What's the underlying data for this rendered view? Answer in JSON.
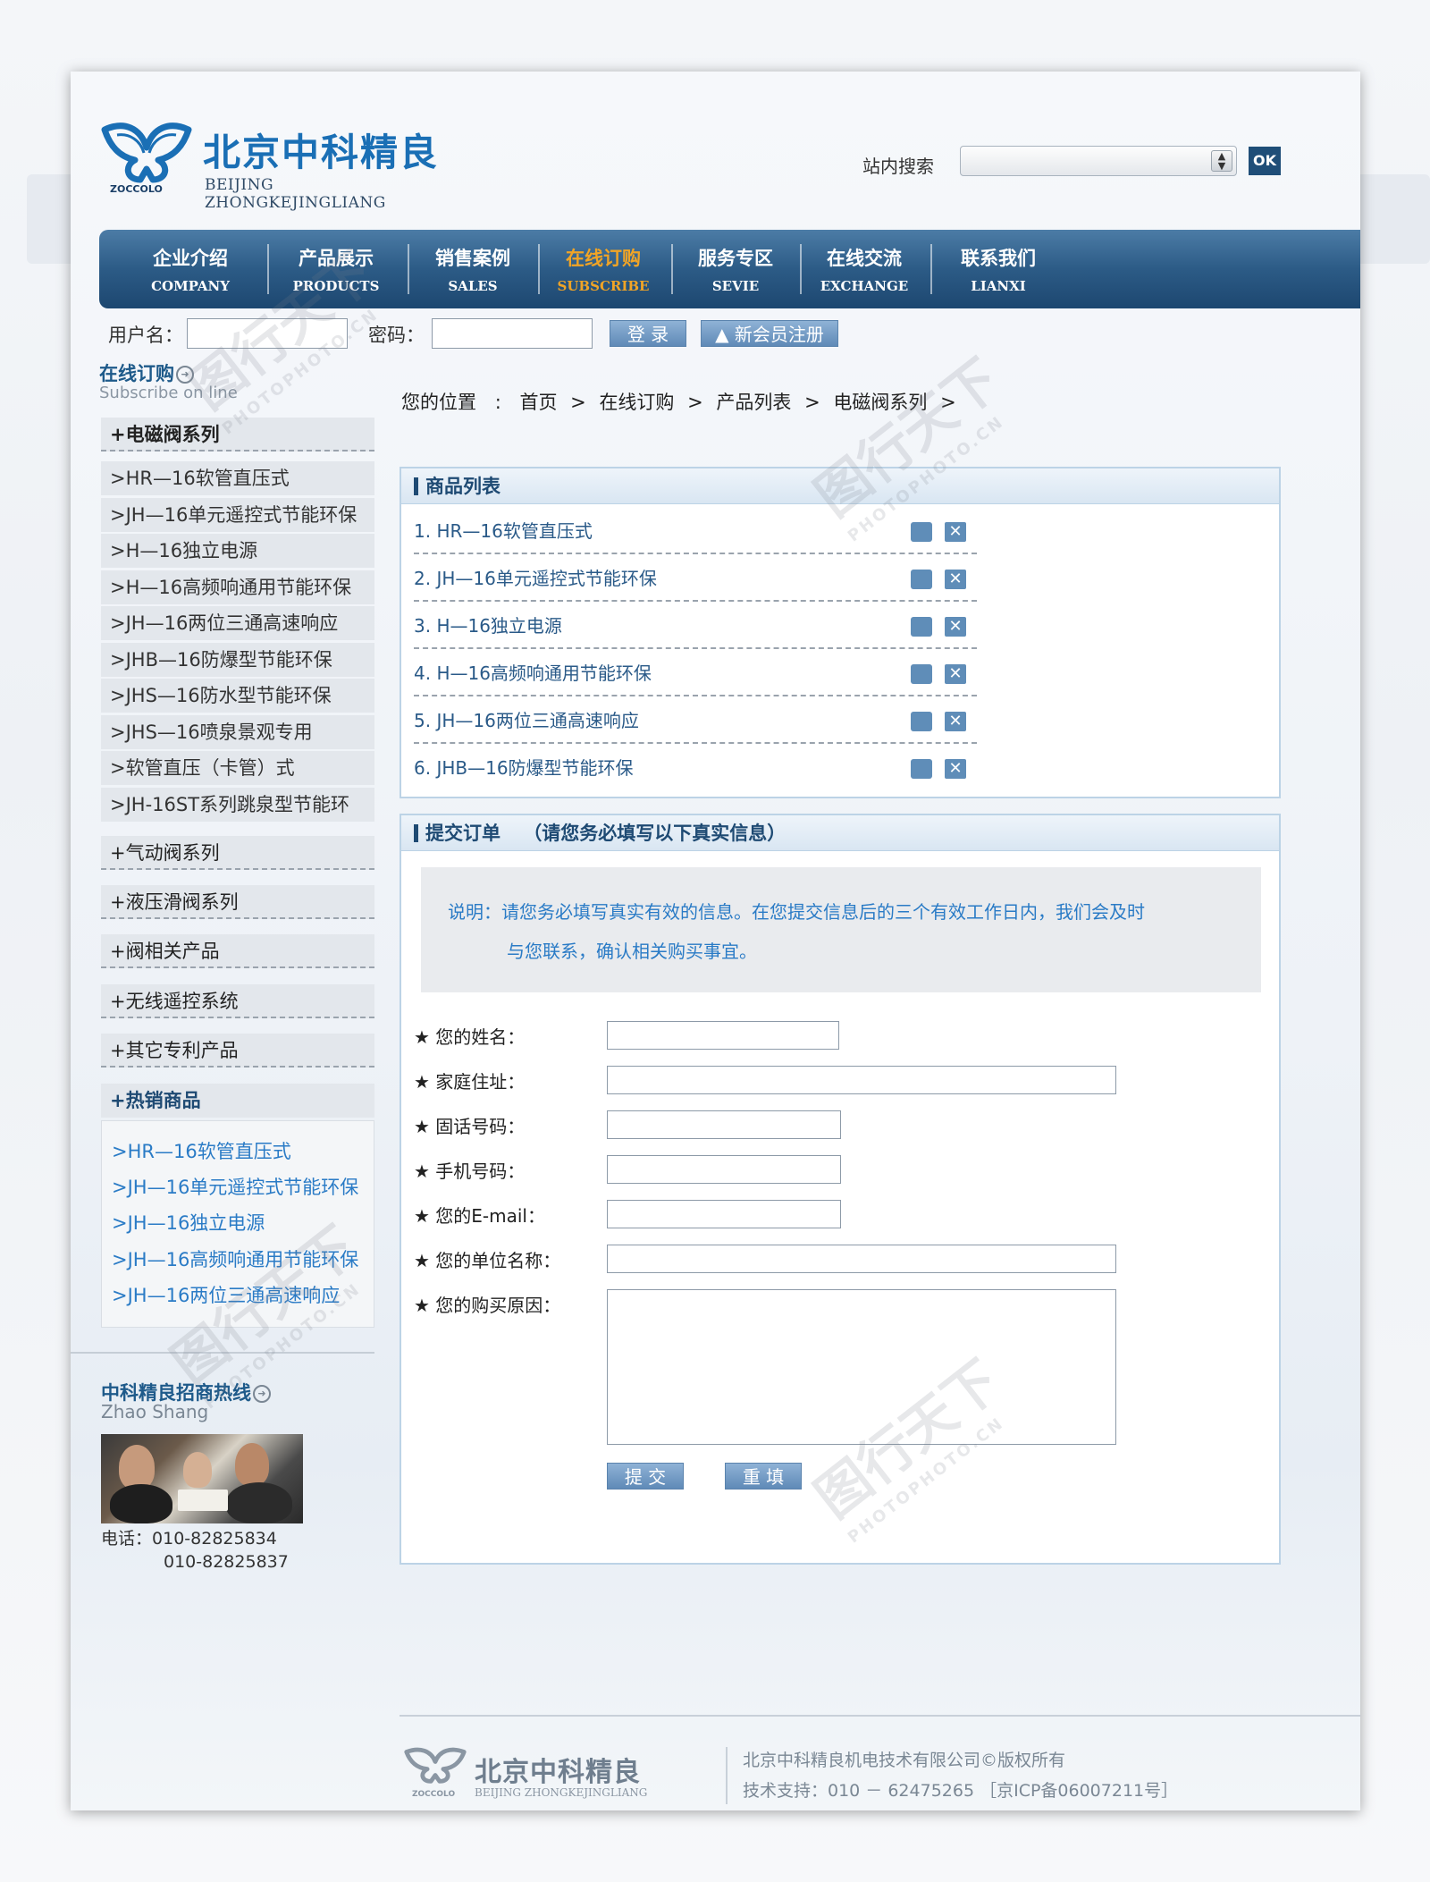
{
  "brand": {
    "name_cn": "北京中科精良",
    "name_en": "BEIJING ZHONGKEJINGLIANG",
    "mark": "ZOCCOLO"
  },
  "search": {
    "label": "站内搜索",
    "ok": "OK"
  },
  "nav": [
    {
      "cn": "企业介绍",
      "en": "COMPANY"
    },
    {
      "cn": "产品展示",
      "en": "PRODUCTS"
    },
    {
      "cn": "销售案例",
      "en": "SALES"
    },
    {
      "cn": "在线订购",
      "en": "SUBSCRIBE"
    },
    {
      "cn": "服务专区",
      "en": "SEVIE"
    },
    {
      "cn": "在线交流",
      "en": "EXCHANGE"
    },
    {
      "cn": "联系我们",
      "en": "LIANXI"
    }
  ],
  "login": {
    "username_label": "用户名：",
    "password_label": "密码：",
    "login_button": "登 录",
    "register_button": "新会员注册"
  },
  "sidebar": {
    "title": "在线订购",
    "subtitle": "Subscribe on line",
    "category_main": "+电磁阀系列",
    "sub_items": [
      ">HR—16软管直压式",
      ">JH—16单元遥控式节能环保",
      ">H—16独立电源",
      ">H—16高频响通用节能环保",
      ">JH—16两位三通高速响应",
      ">JHB—16防爆型节能环保",
      ">JHS—16防水型节能环保",
      ">JHS—16喷泉景观专用",
      ">软管直压（卡管）式",
      ">JH-16ST系列跳泉型节能环"
    ],
    "categories": [
      "+气动阀系列",
      "+液压滑阀系列",
      "+阀相关产品",
      "+无线遥控系统",
      "+其它专利产品"
    ],
    "hot_title": "+热销商品",
    "hot_items": [
      ">HR—16软管直压式",
      ">JH—16单元遥控式节能环保",
      ">JH—16独立电源",
      ">JH—16高频响通用节能环保",
      ">JH—16两位三通高速响应"
    ],
    "hotline_title": "中科精良招商热线",
    "hotline_sub": "Zhao Shang",
    "phone_label": "电话：",
    "phone1": "010-82825834",
    "phone2": "010-82825837"
  },
  "breadcrumb": {
    "label": "您的位置",
    "items": [
      "首页",
      "在线订购",
      "产品列表",
      "电磁阀系列"
    ]
  },
  "product_list": {
    "title": "商品列表",
    "items": [
      "1. HR—16软管直压式",
      "2. JH—16单元遥控式节能环保",
      "3. H—16独立电源",
      "4. H—16高频响通用节能环保",
      "5. JH—16两位三通高速响应",
      "6. JHB—16防爆型节能环保"
    ]
  },
  "order": {
    "title": "提交订单",
    "title_note": "（请您务必填写以下真实信息）",
    "note_line1": "说明：请您务必填写真实有效的信息。在您提交信息后的三个有效工作日内，我们会及时",
    "note_line2": "与您联系，确认相关购买事宜。",
    "fields": [
      "★  您的姓名：",
      "★  家庭住址：",
      "★  固话号码：",
      "★  手机号码：",
      "★  您的E-mail：",
      "★  您的单位名称：",
      "★  您的购买原因："
    ],
    "submit": "提 交",
    "reset": "重 填"
  },
  "footer": {
    "copyright": "北京中科精良机电技术有限公司©版权所有",
    "support": "技术支持：010 － 62475265 ［京ICP备06007211号］"
  }
}
